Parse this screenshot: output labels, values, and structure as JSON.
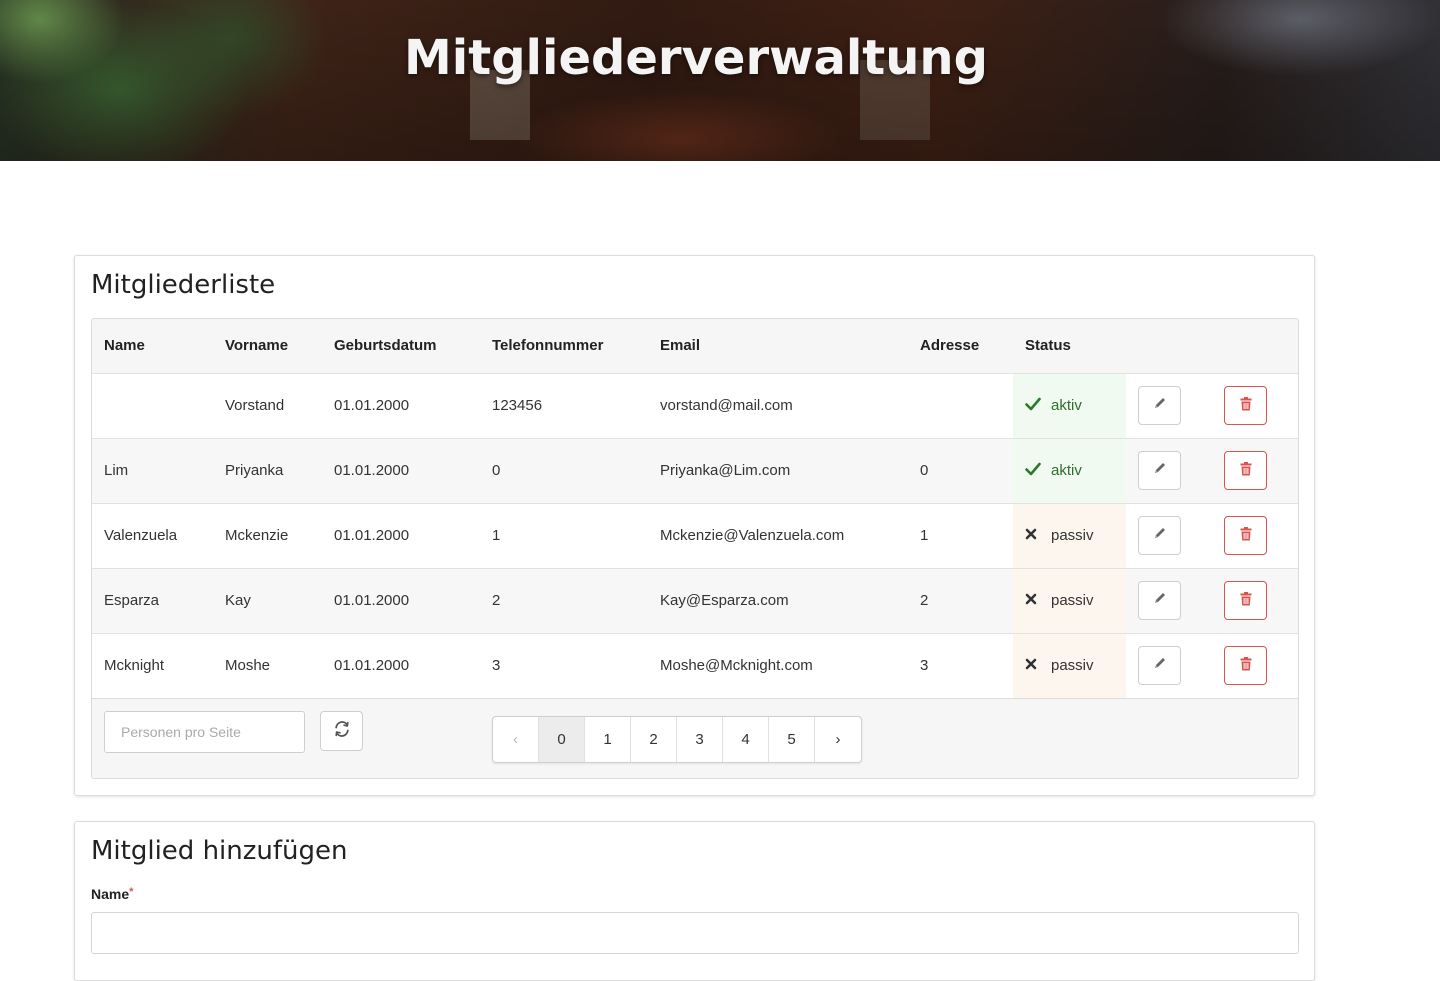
{
  "header": {
    "title": "Mitgliederverwaltung"
  },
  "member_list": {
    "title": "Mitgliederliste",
    "columns": [
      "Name",
      "Vorname",
      "Geburtsdatum",
      "Telefonnummer",
      "Email",
      "Adresse",
      "Status"
    ],
    "rows": [
      {
        "name": "",
        "vorname": "Vorstand",
        "geburtsdatum": "01.01.2000",
        "telefon": "123456",
        "email": "vorstand@mail.com",
        "adresse": "",
        "status": "aktiv",
        "active": true
      },
      {
        "name": "Lim",
        "vorname": "Priyanka",
        "geburtsdatum": "01.01.2000",
        "telefon": "0",
        "email": "Priyanka@Lim.com",
        "adresse": "0",
        "status": "aktiv",
        "active": true
      },
      {
        "name": "Valenzuela",
        "vorname": "Mckenzie",
        "geburtsdatum": "01.01.2000",
        "telefon": "1",
        "email": "Mckenzie@Valenzuela.com",
        "adresse": "1",
        "status": "passiv",
        "active": false
      },
      {
        "name": "Esparza",
        "vorname": "Kay",
        "geburtsdatum": "01.01.2000",
        "telefon": "2",
        "email": "Kay@Esparza.com",
        "adresse": "2",
        "status": "passiv",
        "active": false
      },
      {
        "name": "Mcknight",
        "vorname": "Moshe",
        "geburtsdatum": "01.01.2000",
        "telefon": "3",
        "email": "Moshe@Mcknight.com",
        "adresse": "3",
        "status": "passiv",
        "active": false
      }
    ],
    "per_page_placeholder": "Personen pro Seite",
    "pagination": {
      "prev": "‹",
      "pages": [
        "0",
        "1",
        "2",
        "3",
        "4",
        "5"
      ],
      "current": "0",
      "next": "›"
    }
  },
  "add_member": {
    "title": "Mitglied hinzufügen",
    "name_label": "Name",
    "required_mark": "*"
  },
  "colors": {
    "danger": "#d9534f",
    "success": "#2a7a2a"
  },
  "icons": {
    "edit": "pencil-icon",
    "delete": "trash-icon",
    "refresh": "refresh-icon",
    "active": "check-icon",
    "passive": "x-icon"
  }
}
